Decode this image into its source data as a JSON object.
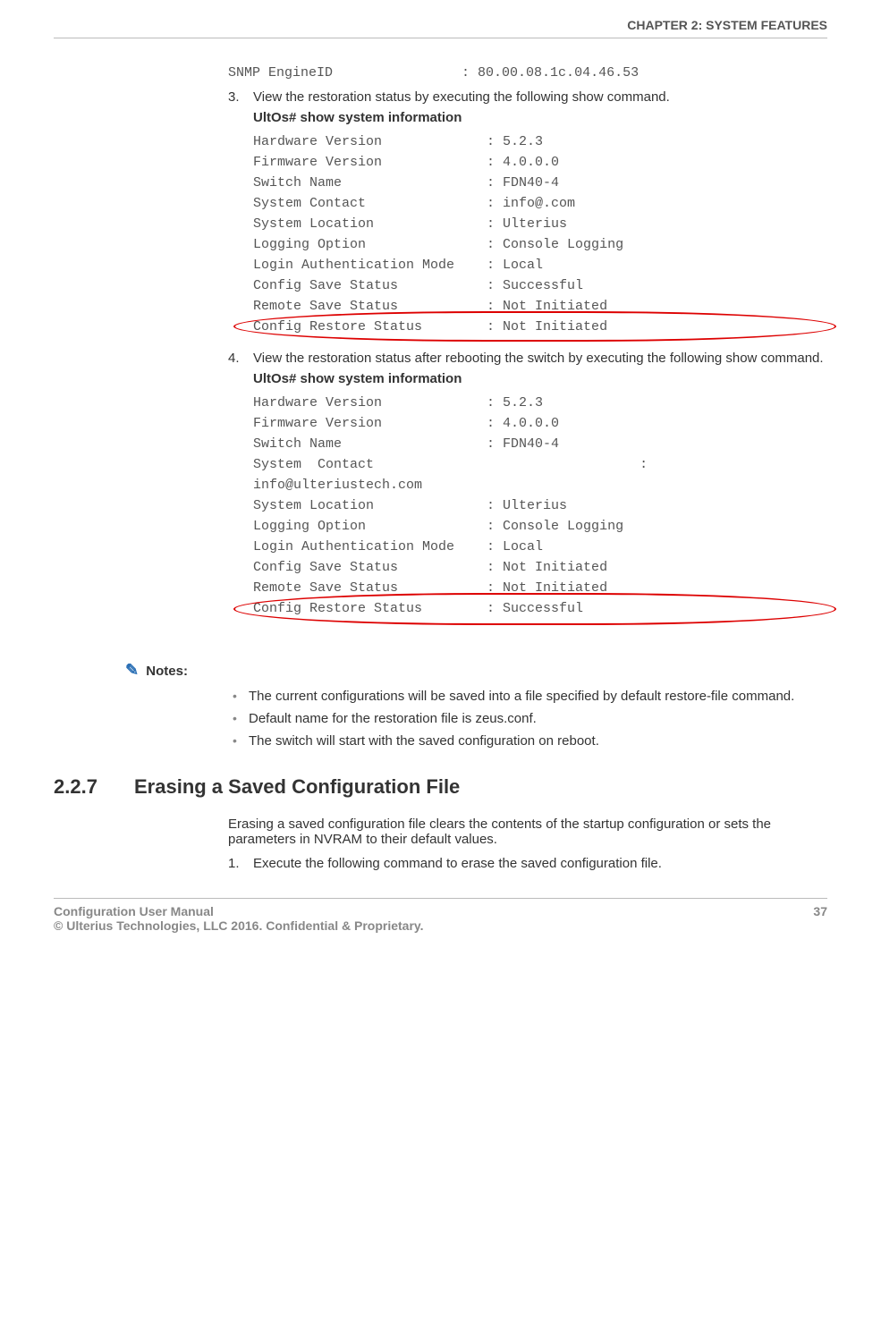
{
  "header": {
    "chapter": "CHAPTER 2: SYSTEM FEATURES"
  },
  "snmp_line": "SNMP EngineID                : 80.00.08.1c.04.46.53",
  "step3": {
    "num": "3.",
    "text": "View the restoration status by executing the following show command.",
    "cmd": "UltOs# show system information",
    "lines": [
      "Hardware Version             : 5.2.3",
      "Firmware Version             : 4.0.0.0",
      "Switch Name                  : FDN40-4",
      "System Contact               : info@.com",
      "System Location              : Ulterius",
      "Logging Option               : Console Logging",
      "Login Authentication Mode    : Local",
      "Config Save Status           : Successful",
      "Remote Save Status           : Not Initiated",
      "Config Restore Status        : Not Initiated"
    ]
  },
  "step4": {
    "num": "4.",
    "text": "View the restoration status after rebooting the switch by executing the following show command.",
    "cmd": "UltOs# show  system information",
    "lines": [
      "Hardware Version             : 5.2.3",
      "Firmware Version             : 4.0.0.0",
      "Switch Name                  : FDN40-4",
      "System  Contact                                 :",
      "info@ulteriustech.com",
      "System Location              : Ulterius",
      "Logging Option               : Console Logging",
      "Login Authentication Mode    : Local",
      "Config Save Status           : Not Initiated",
      "Remote Save Status           : Not Initiated",
      "Config Restore Status        : Successful"
    ]
  },
  "notes": {
    "label": "Notes:",
    "items": [
      "The current configurations will be saved into a file specified by default restore-file command.",
      "Default name for the restoration file is zeus.conf.",
      "The switch will start with the saved configuration on reboot."
    ]
  },
  "section": {
    "num": "2.2.7",
    "title": "Erasing a Saved Configuration File",
    "intro": "Erasing a saved configuration file clears the contents of the startup configuration or sets the parameters in NVRAM to their default values.",
    "step1_num": "1.",
    "step1_text": "Execute the following command to erase the saved configuration file."
  },
  "footer": {
    "left1": "Configuration User Manual",
    "left2": "© Ulterius Technologies, LLC 2016. Confidential & Proprietary.",
    "page": "37"
  }
}
